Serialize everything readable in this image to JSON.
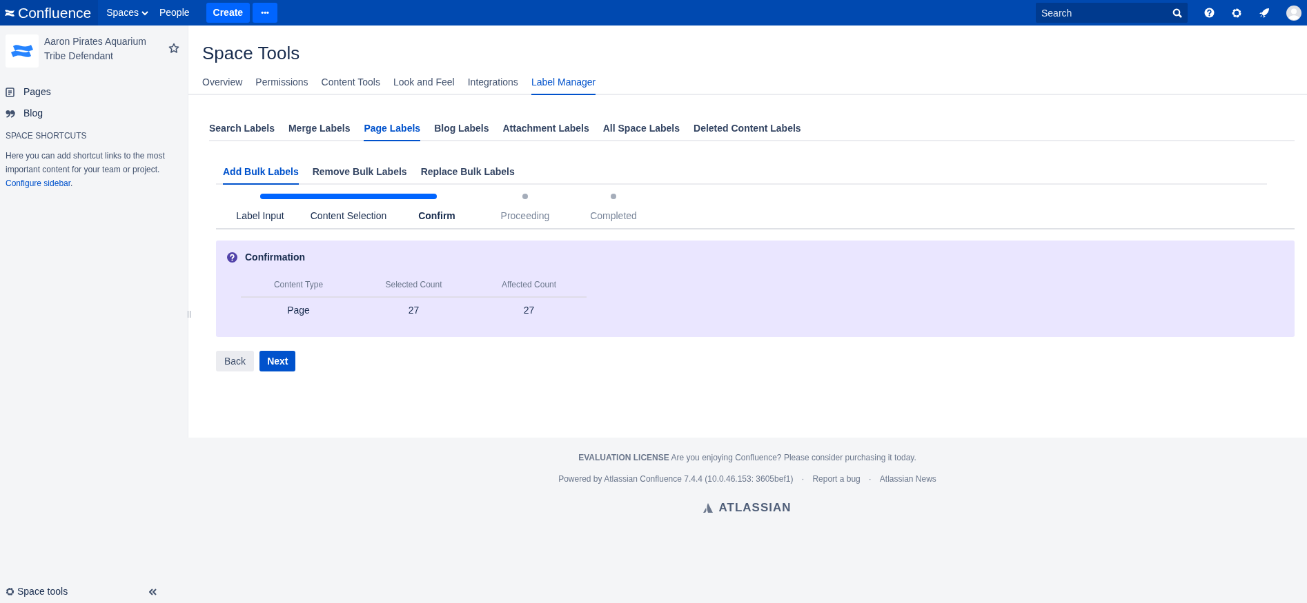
{
  "header": {
    "logo": "Confluence",
    "nav": [
      {
        "label": "Spaces",
        "dropdown": true
      },
      {
        "label": "People",
        "dropdown": false
      }
    ],
    "create": "Create",
    "more": "•••",
    "search": {
      "placeholder": "Search"
    }
  },
  "sidebar": {
    "space_name": "Aaron Pirates Aquarium Tribe Defendant",
    "items": [
      {
        "label": "Pages",
        "kind": "pages"
      },
      {
        "label": "Blog",
        "kind": "blog"
      }
    ],
    "shortcuts_heading": "SPACE SHORTCUTS",
    "shortcuts_text": "Here you can add shortcut links to the most important content for your team or project. ",
    "shortcuts_link": "Configure sidebar",
    "shortcuts_after": ".",
    "space_tools": "Space tools"
  },
  "page_title": "Space Tools",
  "tabs": [
    {
      "label": "Overview",
      "selected": false
    },
    {
      "label": "Permissions",
      "selected": false
    },
    {
      "label": "Content Tools",
      "selected": false
    },
    {
      "label": "Look and Feel",
      "selected": false
    },
    {
      "label": "Integrations",
      "selected": false
    },
    {
      "label": "Label Manager",
      "selected": true
    }
  ],
  "label_tabs": [
    {
      "label": "Search Labels",
      "selected": false
    },
    {
      "label": "Merge Labels",
      "selected": false
    },
    {
      "label": "Page Labels",
      "selected": true
    },
    {
      "label": "Blog Labels",
      "selected": false
    },
    {
      "label": "Attachment Labels",
      "selected": false
    },
    {
      "label": "All Space Labels",
      "selected": false
    },
    {
      "label": "Deleted Content Labels",
      "selected": false
    }
  ],
  "bulk_tabs": [
    {
      "label": "Add Bulk Labels",
      "selected": true
    },
    {
      "label": "Remove Bulk Labels",
      "selected": false
    },
    {
      "label": "Replace Bulk Labels",
      "selected": false
    }
  ],
  "steps": [
    {
      "label": "Label Input",
      "reached": true,
      "current": false
    },
    {
      "label": "Content Selection",
      "reached": true,
      "current": false
    },
    {
      "label": "Confirm",
      "reached": true,
      "current": true
    },
    {
      "label": "Proceeding",
      "reached": false,
      "current": false
    },
    {
      "label": "Completed",
      "reached": false,
      "current": false
    }
  ],
  "confirmation": {
    "title": "Confirmation",
    "columns": [
      "Content Type",
      "Selected Count",
      "Affected Count"
    ],
    "rows": [
      [
        "Page",
        "27",
        "27"
      ]
    ]
  },
  "buttons": [
    {
      "label": "Back",
      "kind": "secondary"
    },
    {
      "label": "Next",
      "kind": "primary"
    }
  ],
  "footer": {
    "license": "**EVALUATION LICENSE** Are you enjoying Confluence? Please consider purchasing it today.",
    "powered_by": "Powered by Atlassian Confluence 7.4.4 (10.0.46.153: 3605bef1)",
    "links": [
      {
        "separator": "·",
        "label": "Report a bug"
      },
      {
        "separator": "·",
        "label": "Atlassian News"
      }
    ],
    "brand": "ATLASSIAN"
  }
}
